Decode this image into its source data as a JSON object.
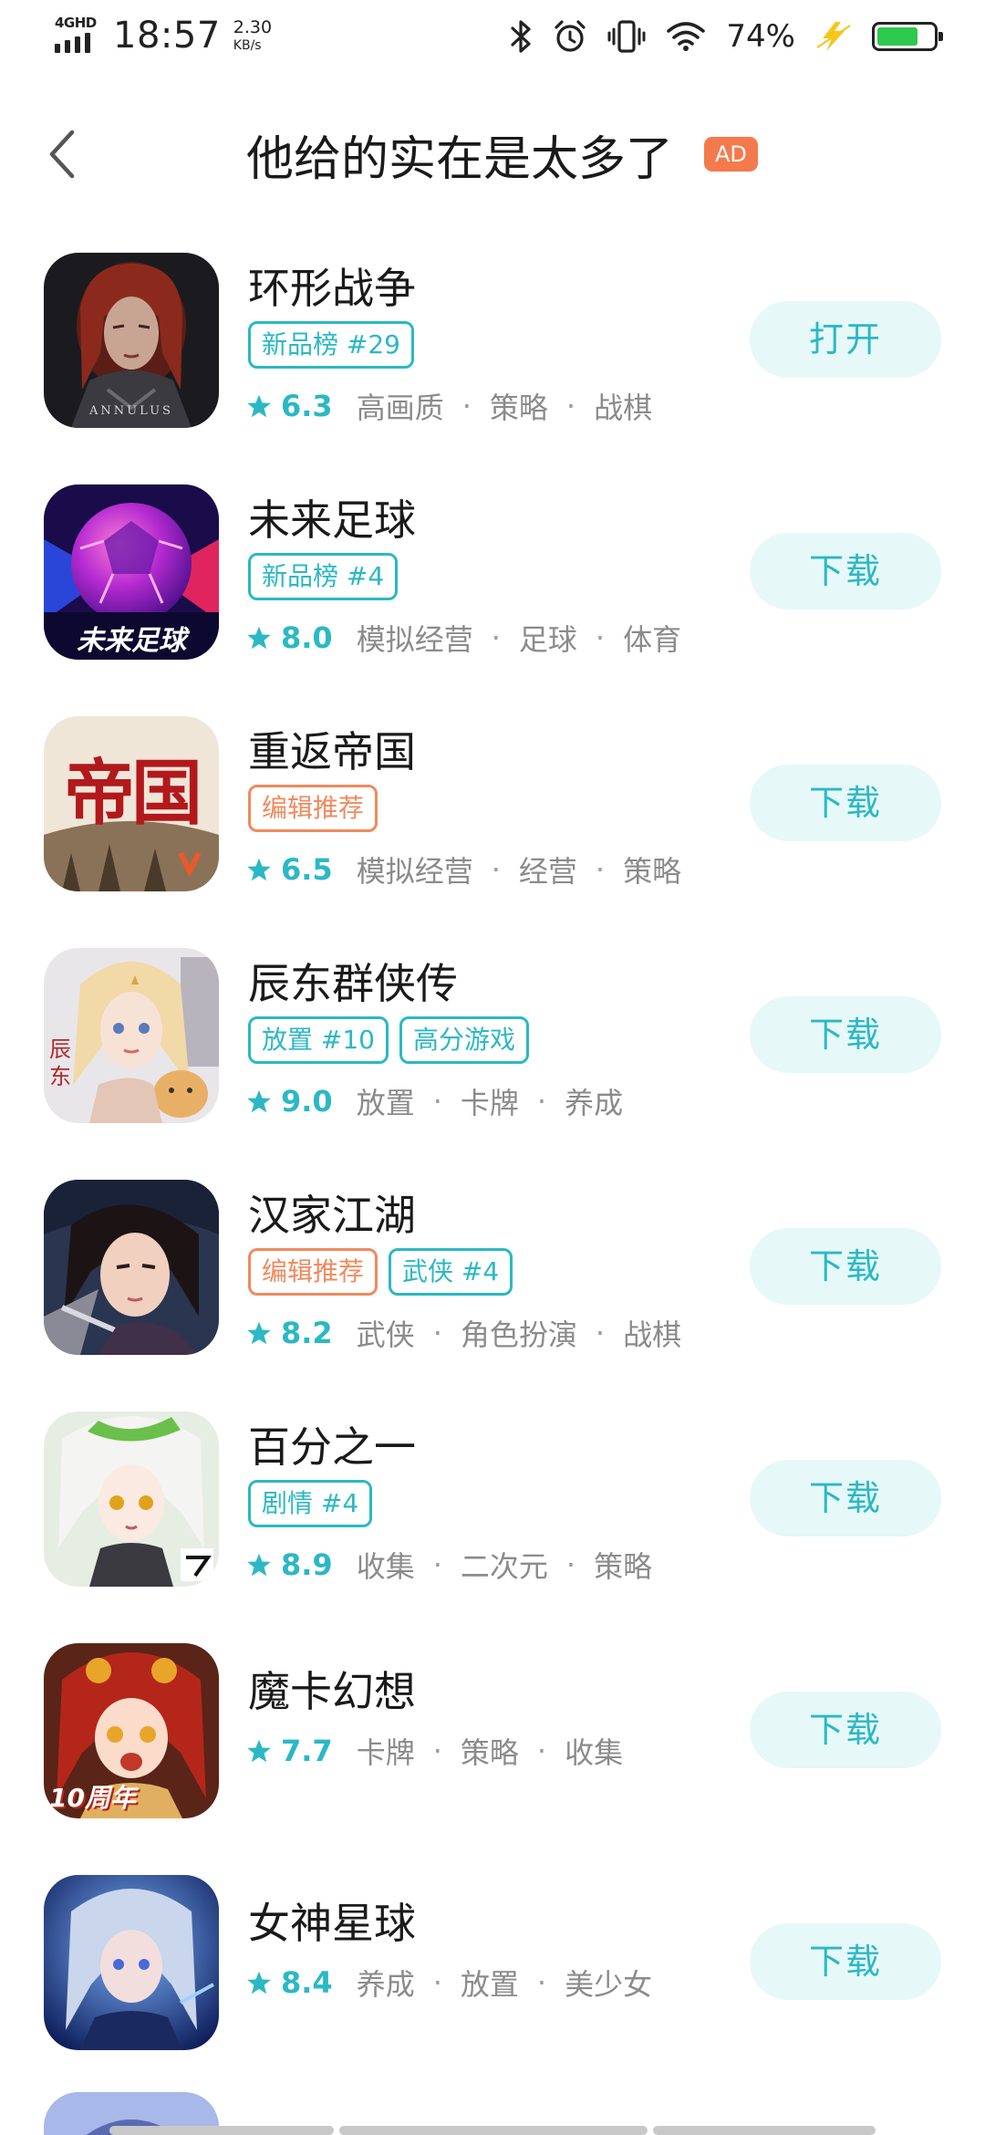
{
  "status_bar": {
    "network": "4GHD",
    "time": "18:57",
    "speed_value": "2.30",
    "speed_unit": "KB/s",
    "battery": "74%",
    "icons": [
      "signal-icon",
      "bluetooth-icon",
      "alarm-icon",
      "vibrate-icon",
      "wifi-icon",
      "charging-icon",
      "battery-icon"
    ]
  },
  "header": {
    "title": "他给的实在是太多了",
    "ad_label": "AD"
  },
  "colors": {
    "accent": "#2bb8c4",
    "tag_orange": "#f08a5d",
    "ad_orange": "#f47a4c",
    "button_bg": "#e6f8f8",
    "meta_gray": "#8b8b8b",
    "battery_green": "#2dc84d"
  },
  "apps": [
    {
      "name": "环形战争",
      "tags": [
        {
          "text": "新品榜 #29",
          "color": "teal"
        }
      ],
      "rating": "6.3",
      "categories": [
        "高画质",
        "策略",
        "战棋"
      ],
      "button": "打开"
    },
    {
      "name": "未来足球",
      "tags": [
        {
          "text": "新品榜 #4",
          "color": "teal"
        }
      ],
      "rating": "8.0",
      "categories": [
        "模拟经营",
        "足球",
        "体育"
      ],
      "button": "下载"
    },
    {
      "name": "重返帝国",
      "tags": [
        {
          "text": "编辑推荐",
          "color": "orange"
        }
      ],
      "rating": "6.5",
      "categories": [
        "模拟经营",
        "经营",
        "策略"
      ],
      "button": "下载"
    },
    {
      "name": "辰东群侠传",
      "tags": [
        {
          "text": "放置 #10",
          "color": "teal"
        },
        {
          "text": "高分游戏",
          "color": "teal"
        }
      ],
      "rating": "9.0",
      "categories": [
        "放置",
        "卡牌",
        "养成"
      ],
      "button": "下载"
    },
    {
      "name": "汉家江湖",
      "tags": [
        {
          "text": "编辑推荐",
          "color": "orange"
        },
        {
          "text": "武侠 #4",
          "color": "teal"
        }
      ],
      "rating": "8.2",
      "categories": [
        "武侠",
        "角色扮演",
        "战棋"
      ],
      "button": "下载"
    },
    {
      "name": "百分之一",
      "tags": [
        {
          "text": "剧情 #4",
          "color": "teal"
        }
      ],
      "rating": "8.9",
      "categories": [
        "收集",
        "二次元",
        "策略"
      ],
      "button": "下载"
    },
    {
      "name": "魔卡幻想",
      "tags": [],
      "rating": "7.7",
      "categories": [
        "卡牌",
        "策略",
        "收集"
      ],
      "button": "下载"
    },
    {
      "name": "女神星球",
      "tags": [],
      "rating": "8.4",
      "categories": [
        "养成",
        "放置",
        "美少女"
      ],
      "button": "下载"
    }
  ],
  "icon_text": {
    "annulus": "ANNULUS",
    "future_football": "未来足球",
    "empire": "帝国",
    "chendong": "辰东",
    "anniversary": "10周年"
  }
}
